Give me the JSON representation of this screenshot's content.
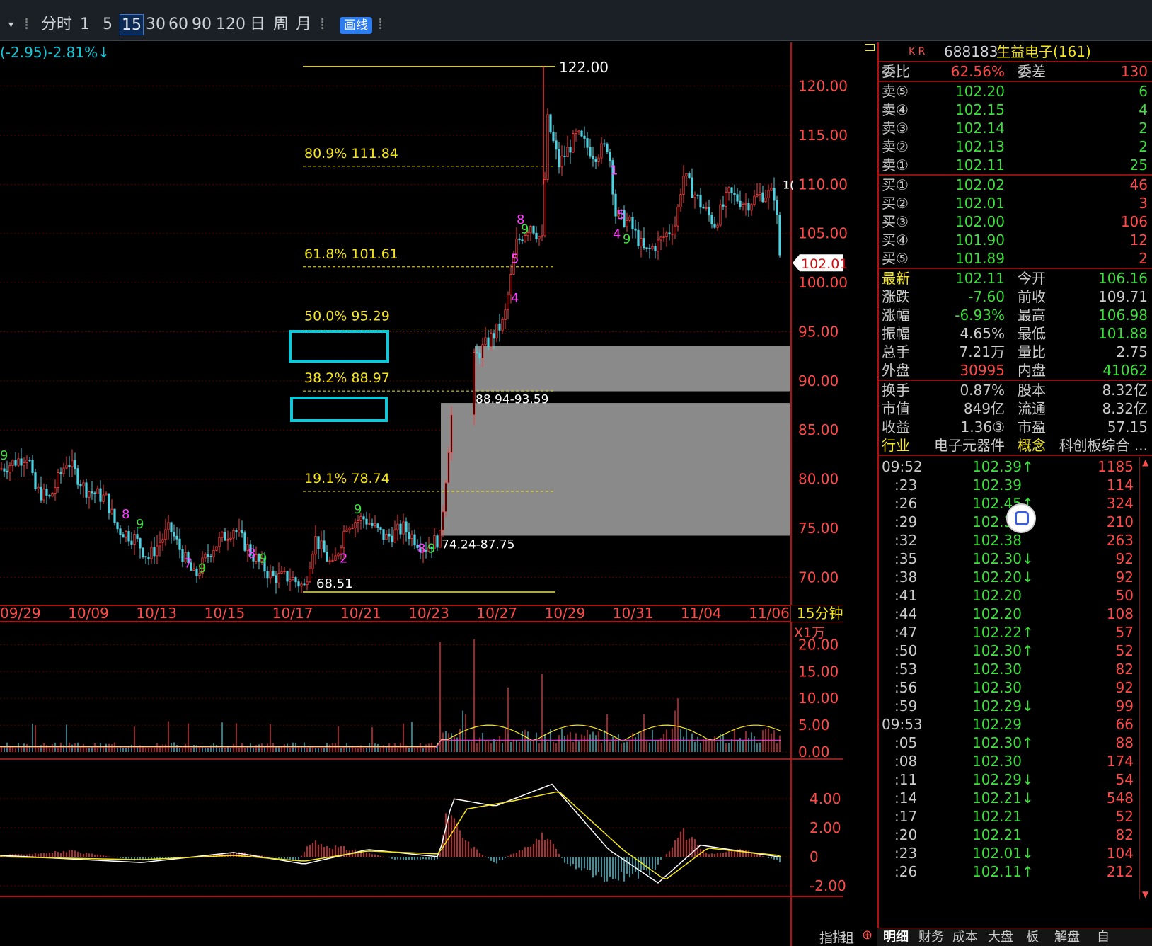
{
  "toolbar": {
    "items": [
      "分时",
      "1",
      "5",
      "15",
      "30",
      "60",
      "90",
      "120",
      "日",
      "周",
      "月"
    ],
    "active": "15",
    "draw_label": "画线"
  },
  "chart_header": {
    "change": "(-2.95)-2.81%↓"
  },
  "stock": {
    "code": "688183",
    "name": "生益电子(161)",
    "marks": "K R"
  },
  "main_chart": {
    "period_label": "15分钟",
    "price_axis": [
      "120.00",
      "115.00",
      "110.00",
      "105.00",
      "100.00",
      "95.00",
      "90.00",
      "85.00",
      "80.00",
      "75.00",
      "70.00"
    ],
    "dates": [
      "09/29",
      "10/09",
      "10/13",
      "10/15",
      "10/17",
      "10/21",
      "10/23",
      "10/27",
      "10/29",
      "10/31",
      "11/04",
      "11/06"
    ],
    "current_price_tag": "102.01",
    "high_label": "122.00",
    "low_label": "68.51",
    "fib_levels": [
      {
        "label": "80.9% 111.84"
      },
      {
        "label": "61.8% 101.61"
      },
      {
        "label": "50.0% 95.29"
      },
      {
        "label": "38.2% 88.97"
      },
      {
        "label": "19.1% 78.74"
      }
    ],
    "gap_labels": [
      "88.94-93.59",
      "74.24-87.75"
    ],
    "right_edge_label": "1("
  },
  "volume_chart": {
    "unit_label": "X1万",
    "axis": [
      "20.00",
      "15.00",
      "10.00",
      "5.00",
      "0.00"
    ]
  },
  "macd_chart": {
    "axis": [
      "4.00",
      "2.00",
      "0",
      "-2.00"
    ]
  },
  "chart_data": {
    "type": "candlestick",
    "title": "",
    "xlabel": "",
    "ylabel": "",
    "ylim": [
      67.5,
      123
    ],
    "x": [
      "09/29",
      "10/09",
      "10/13",
      "10/15",
      "10/17",
      "10/21",
      "10/23",
      "10/27",
      "10/29",
      "10/31",
      "11/04",
      "11/06"
    ],
    "close_approx": [
      82.5,
      80.5,
      72,
      74,
      70,
      75.5,
      73,
      96,
      116,
      104,
      109,
      102
    ],
    "high": 122.0,
    "low": 68.51
  },
  "quote": {
    "weibi": {
      "label": "委比",
      "value": "62.56%",
      "label2": "委差",
      "value2": "130"
    },
    "sell": [
      {
        "label": "卖⑤",
        "price": "102.20",
        "vol": "6"
      },
      {
        "label": "卖④",
        "price": "102.15",
        "vol": "4"
      },
      {
        "label": "卖③",
        "price": "102.14",
        "vol": "2"
      },
      {
        "label": "卖②",
        "price": "102.13",
        "vol": "2"
      },
      {
        "label": "卖①",
        "price": "102.11",
        "vol": "25"
      }
    ],
    "buy": [
      {
        "label": "买①",
        "price": "102.02",
        "vol": "46"
      },
      {
        "label": "买②",
        "price": "102.01",
        "vol": "3"
      },
      {
        "label": "买③",
        "price": "102.00",
        "vol": "106"
      },
      {
        "label": "买④",
        "price": "101.90",
        "vol": "12"
      },
      {
        "label": "买⑤",
        "price": "101.89",
        "vol": "2"
      }
    ],
    "stats": [
      {
        "l1": "最新",
        "v1": "102.11",
        "l2": "今开",
        "v2": "106.16"
      },
      {
        "l1": "涨跌",
        "v1": "-7.60",
        "l2": "前收",
        "v2": "109.71"
      },
      {
        "l1": "涨幅",
        "v1": "-6.93%",
        "l2": "最高",
        "v2": "106.98"
      },
      {
        "l1": "振幅",
        "v1": "4.65%",
        "l2": "最低",
        "v2": "101.88"
      },
      {
        "l1": "总手",
        "v1": "7.21万",
        "l2": "量比",
        "v2": "2.75"
      },
      {
        "l1": "外盘",
        "v1": "30995",
        "l2": "内盘",
        "v2": "41062"
      }
    ],
    "fund": [
      {
        "l1": "换手",
        "v1": "0.87%",
        "l2": "股本",
        "v2": "8.32亿"
      },
      {
        "l1": "市值",
        "v1": "849亿",
        "l2": "流通",
        "v2": "8.32亿"
      },
      {
        "l1": "收益",
        "v1": "1.36③",
        "l2": "市盈",
        "v2": "57.15"
      },
      {
        "l1": "行业",
        "v1": "电子元器件",
        "l2": "概念",
        "v2": "科创板综合 ..."
      }
    ]
  },
  "ticks": [
    {
      "t": "09:52",
      "p": "102.39↑",
      "v": "1185"
    },
    {
      "t": ":23",
      "p": "102.39",
      "v": "114"
    },
    {
      "t": ":26",
      "p": "102.45↑",
      "v": "324"
    },
    {
      "t": ":29",
      "p": "102.38↓",
      "v": "210"
    },
    {
      "t": ":32",
      "p": "102.38",
      "v": "263"
    },
    {
      "t": ":35",
      "p": "102.30↓",
      "v": "92"
    },
    {
      "t": ":38",
      "p": "102.20↓",
      "v": "92"
    },
    {
      "t": ":41",
      "p": "102.20",
      "v": "50"
    },
    {
      "t": ":44",
      "p": "102.20",
      "v": "108"
    },
    {
      "t": ":47",
      "p": "102.22↑",
      "v": "57"
    },
    {
      "t": ":50",
      "p": "102.30↑",
      "v": "52"
    },
    {
      "t": ":53",
      "p": "102.30",
      "v": "82"
    },
    {
      "t": ":56",
      "p": "102.30",
      "v": "92"
    },
    {
      "t": ":59",
      "p": "102.29↓",
      "v": "99"
    },
    {
      "t": "09:53",
      "p": "102.29",
      "v": "66"
    },
    {
      "t": ":05",
      "p": "102.30↑",
      "v": "88"
    },
    {
      "t": ":08",
      "p": "102.30",
      "v": "174"
    },
    {
      "t": ":11",
      "p": "102.29↓",
      "v": "54"
    },
    {
      "t": ":14",
      "p": "102.21↓",
      "v": "548"
    },
    {
      "t": ":17",
      "p": "102.21",
      "v": "52"
    },
    {
      "t": ":20",
      "p": "102.21",
      "v": "82"
    },
    {
      "t": ":23",
      "p": "102.01↓",
      "v": "104"
    },
    {
      "t": ":26",
      "p": "102.11↑",
      "v": "212"
    }
  ],
  "bottom_tabs": [
    "指",
    "组",
    "明细",
    "财务",
    "成本",
    "大盘",
    "板",
    "解盘",
    "自"
  ],
  "colors": {
    "red": "#ff4a4a",
    "green": "#3dde3d",
    "yellow": "#f5e61c",
    "cyan": "#12c8d8",
    "gray_box": "#8a8a8a"
  }
}
